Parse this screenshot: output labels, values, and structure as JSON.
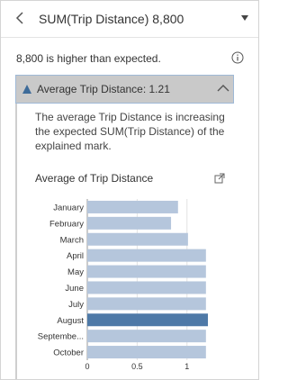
{
  "header": {
    "title": "SUM(Trip Distance)  8,800",
    "back_icon": "chevron-left-icon",
    "menu_icon": "caret-down-icon"
  },
  "summary": {
    "text": "8,800 is higher than expected.",
    "info_icon": "info-icon"
  },
  "section": {
    "label": "Average Trip Distance: 1.21",
    "icon": "triangle-up-icon",
    "collapse_icon": "chevron-up-icon",
    "explanation": "The average Trip Distance is increasing the expected SUM(Trip Distance) of the explained mark."
  },
  "colors": {
    "bar": "#b5c6dc",
    "bar_highlight": "#4e79a7",
    "accent": "#3d6b99"
  },
  "chart_data": {
    "type": "bar",
    "orientation": "horizontal",
    "title": "Average of Trip Distance",
    "popout_icon": "popout-icon",
    "categories": [
      "January",
      "February",
      "March",
      "April",
      "May",
      "June",
      "July",
      "August",
      "Septembe...",
      "October"
    ],
    "values": [
      0.91,
      0.84,
      1.01,
      1.19,
      1.19,
      1.19,
      1.19,
      1.21,
      1.19,
      1.19
    ],
    "highlighted": "August",
    "x_ticks": [
      "0",
      "0.5",
      "1"
    ],
    "xlim": [
      0,
      1.3
    ],
    "grid": true
  }
}
